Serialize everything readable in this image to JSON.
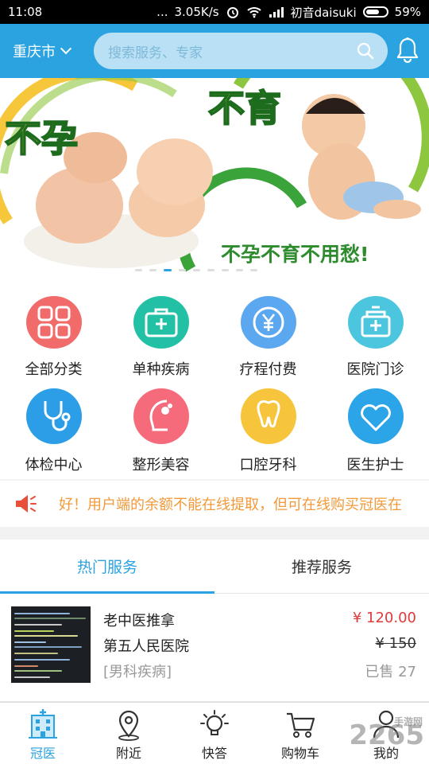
{
  "status_bar": {
    "time": "11:08",
    "dots": "...",
    "network_speed": "3.05K/s",
    "carrier": "初音daisuki",
    "battery": "59%"
  },
  "header": {
    "city": "重庆市",
    "search_placeholder": "搜索服务、专家"
  },
  "banner": {
    "text_1": "不孕",
    "text_2": "不育",
    "slogan": "不孕不育不用愁!",
    "dot_count": 9,
    "active_dot": 2
  },
  "categories": [
    {
      "label": "全部分类",
      "icon": "grid-icon",
      "color": "#f26b6b"
    },
    {
      "label": "单种疾病",
      "icon": "medical-kit-icon",
      "color": "#22c1a6"
    },
    {
      "label": "疗程付费",
      "icon": "yen-icon",
      "color": "#5ba8f0"
    },
    {
      "label": "医院门诊",
      "icon": "hospital-icon",
      "color": "#4cc6de"
    },
    {
      "label": "体检中心",
      "icon": "stethoscope-icon",
      "color": "#2c9ee8"
    },
    {
      "label": "整形美容",
      "icon": "face-icon",
      "color": "#f56b7c"
    },
    {
      "label": "口腔牙科",
      "icon": "tooth-icon",
      "color": "#f7c53b"
    },
    {
      "label": "医生护士",
      "icon": "heart-icon",
      "color": "#2ba4e8"
    }
  ],
  "notice": {
    "text": "好！用户端的余额不能在线提取，但可在线购买冠医在"
  },
  "tabs": [
    {
      "label": "热门服务",
      "active": true
    },
    {
      "label": "推荐服务",
      "active": false
    }
  ],
  "product": {
    "name": "老中医推拿",
    "hospital": "第五人民医院",
    "tag": "[男科疾病]",
    "price": "¥ 120.00",
    "original_price": "¥ 150",
    "sold": "已售 27"
  },
  "bottom_nav": [
    {
      "label": "冠医",
      "icon": "hospital-building-icon",
      "active": true
    },
    {
      "label": "附近",
      "icon": "location-pin-icon",
      "active": false
    },
    {
      "label": "快答",
      "icon": "lightbulb-icon",
      "active": false
    },
    {
      "label": "购物车",
      "icon": "cart-icon",
      "active": false
    },
    {
      "label": "我的",
      "icon": "person-icon",
      "active": false
    }
  ],
  "watermark": {
    "brand": "2265",
    "suffix": "手游网"
  },
  "colors": {
    "primary": "#2aa3e0",
    "price_red": "#e03a3a",
    "notice_orange": "#f29a3a"
  }
}
